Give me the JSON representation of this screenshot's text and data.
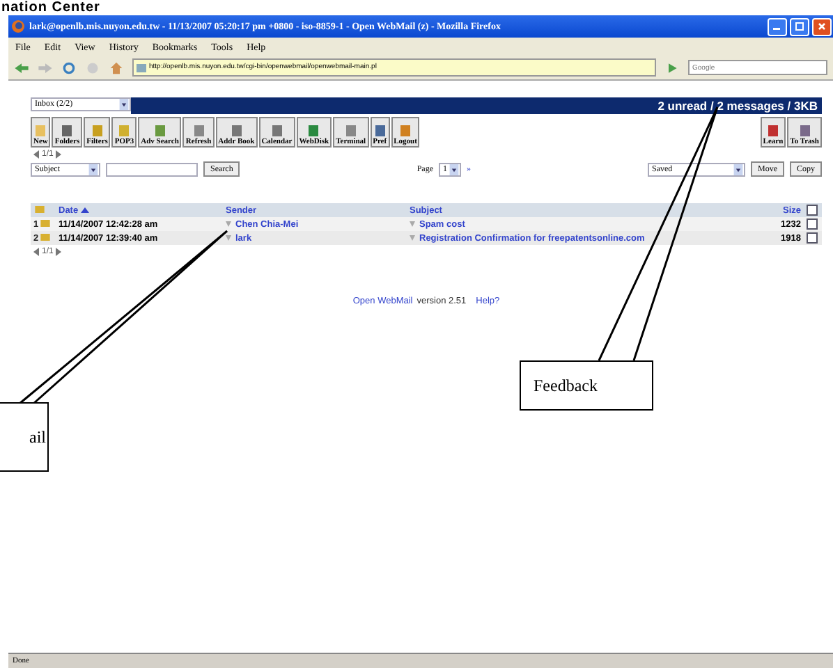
{
  "document_header": {
    "text": "nation Center"
  },
  "window": {
    "title": "lark@openlb.mis.nuyon.edu.tw - 11/13/2007 05:20:17 pm +0800 - iso-8859-1 - Open WebMail (z) - Mozilla Firefox"
  },
  "menu": [
    "File",
    "Edit",
    "View",
    "History",
    "Bookmarks",
    "Tools",
    "Help"
  ],
  "address_bar": {
    "value": "http://openlb.mis.nuyon.edu.tw/cgi-bin/openwebmail/openwebmail-main.pl"
  },
  "web_search": {
    "placeholder": "Google"
  },
  "folder_select": {
    "value": "Inbox (2/2)"
  },
  "summary": "2 unread / 2 messages / 3KB",
  "toolbar": [
    {
      "label": "New",
      "kind": "new"
    },
    {
      "label": "Folders",
      "kind": "folders"
    },
    {
      "label": "Filters",
      "kind": "filters"
    },
    {
      "label": "POP3",
      "kind": "pop3"
    },
    {
      "label": "Adv Search",
      "kind": "search"
    },
    {
      "label": "Refresh",
      "kind": "refresh"
    },
    {
      "label": "Addr Book",
      "kind": "book"
    },
    {
      "label": "Calendar",
      "kind": "calendar"
    },
    {
      "label": "WebDisk",
      "kind": "disk"
    },
    {
      "label": "Terminal",
      "kind": "terminal"
    },
    {
      "label": "Pref",
      "kind": "pref"
    },
    {
      "label": "Logout",
      "kind": "logout"
    }
  ],
  "toolbar_right": [
    {
      "label": "Learn",
      "kind": "learn"
    },
    {
      "label": "To Trash",
      "kind": "trash"
    }
  ],
  "pager_top": "1/1",
  "search_row": {
    "field": "Subject",
    "search_button": "Search",
    "page_label": "Page",
    "page": "1",
    "next": "»",
    "target": "Saved",
    "move": "Move",
    "copy": "Copy"
  },
  "table": {
    "columns": [
      "Date",
      "Sender",
      "Subject",
      "Size"
    ],
    "select_all_checked": false,
    "rows": [
      {
        "number": "1",
        "date": "11/14/2007 12:42:28 am",
        "sender": "Chen Chia-Mei",
        "subject": "Spam cost",
        "size": "1232",
        "checked": false
      },
      {
        "number": "2",
        "date": "11/14/2007 12:39:40 am",
        "sender": "lark",
        "subject": "Registration Confirmation for freepatentsonline.com",
        "size": "1918",
        "checked": false
      }
    ]
  },
  "pager_bottom": "1/1",
  "footer": {
    "link": "Open WebMail",
    "version": "version 2.51",
    "help": "Help?"
  },
  "callouts": [
    {
      "text": "ail"
    },
    {
      "text": "Feedback"
    }
  ],
  "status_bar": "Done"
}
